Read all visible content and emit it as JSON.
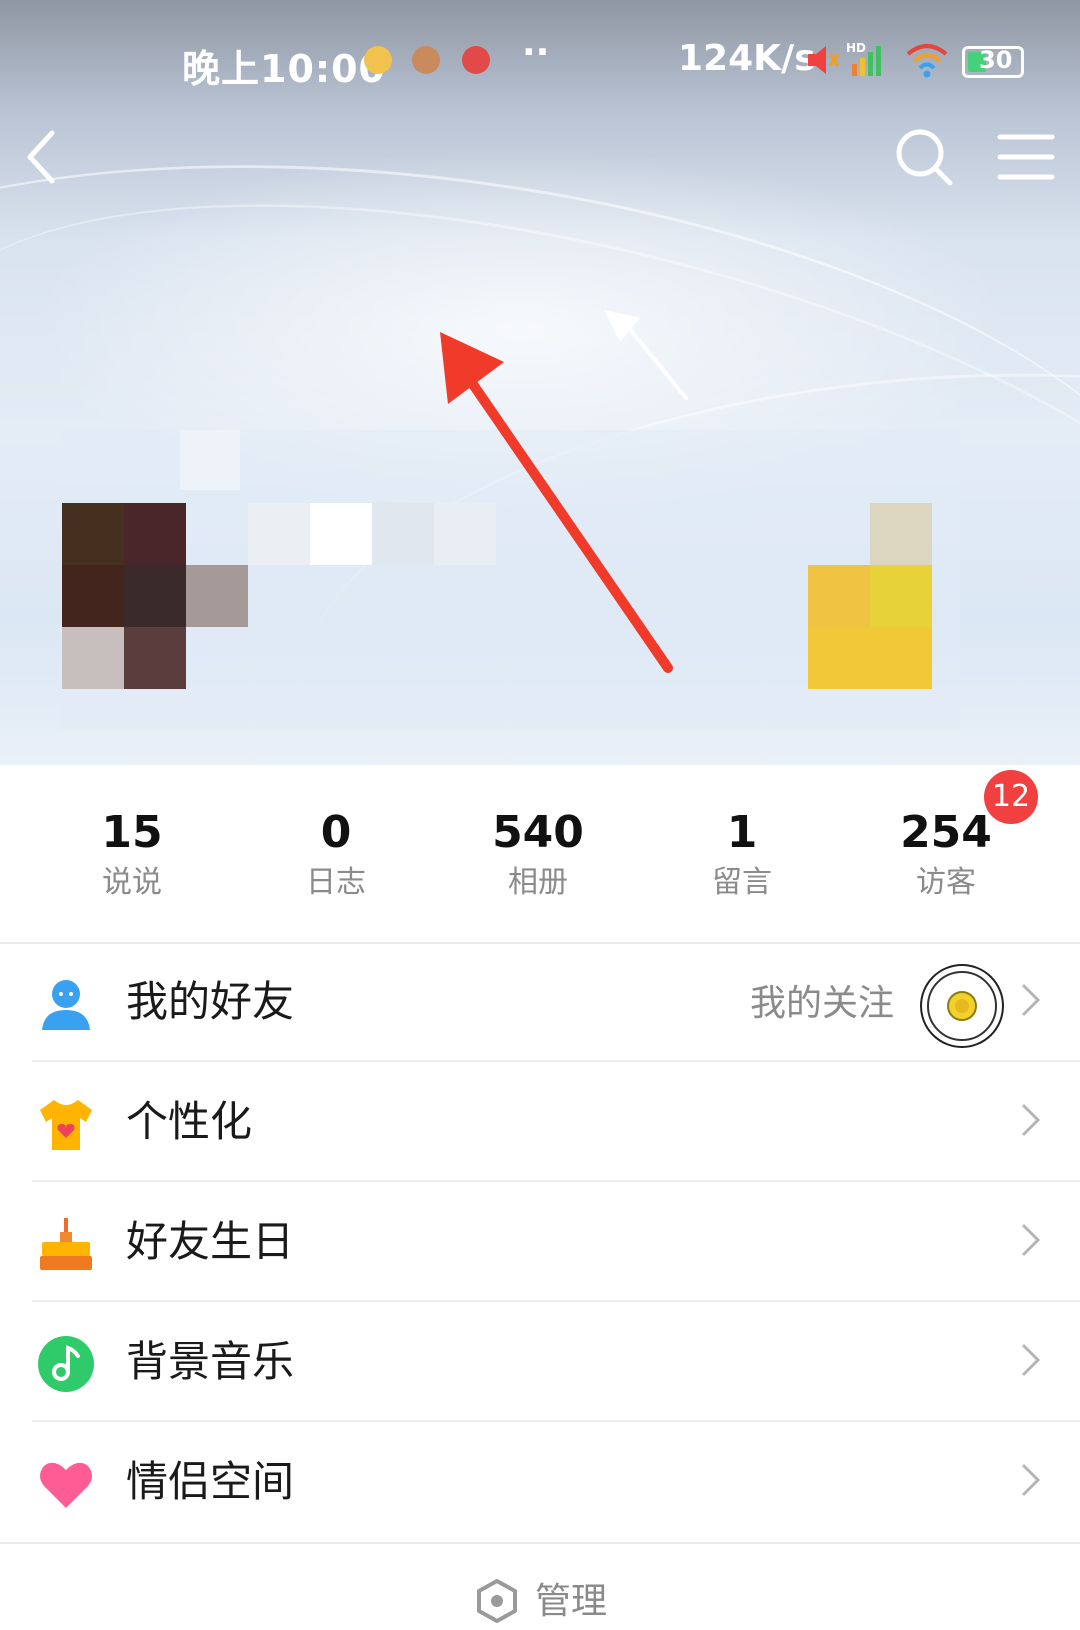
{
  "status_bar": {
    "time": "晚上10:00",
    "net_speed": "124K/s",
    "battery": "30",
    "dots": "··"
  },
  "header": {
    "back_icon": "chevron-left-icon",
    "search_icon": "search-icon",
    "menu_icon": "menu-icon"
  },
  "stats": [
    {
      "value": "15",
      "label": "说说"
    },
    {
      "value": "0",
      "label": "日志"
    },
    {
      "value": "540",
      "label": "相册"
    },
    {
      "value": "1",
      "label": "留言"
    },
    {
      "value": "254",
      "label": "访客"
    }
  ],
  "visitor_badge": "12",
  "menu": [
    {
      "label": "我的好友",
      "icon": "person-icon",
      "sub": "我的关注"
    },
    {
      "label": "个性化",
      "icon": "tshirt-icon"
    },
    {
      "label": "好友生日",
      "icon": "cake-icon"
    },
    {
      "label": "背景音乐",
      "icon": "music-note-icon"
    },
    {
      "label": "情侣空间",
      "icon": "heart-icon"
    }
  ],
  "manage_label": "管理",
  "colors": {
    "accent_red": "#f04040",
    "friend_icon": "#3aa0f0",
    "music_icon": "#2fca6a",
    "heart_icon": "#ff5b94",
    "shirt_icon": "#ffb400"
  }
}
